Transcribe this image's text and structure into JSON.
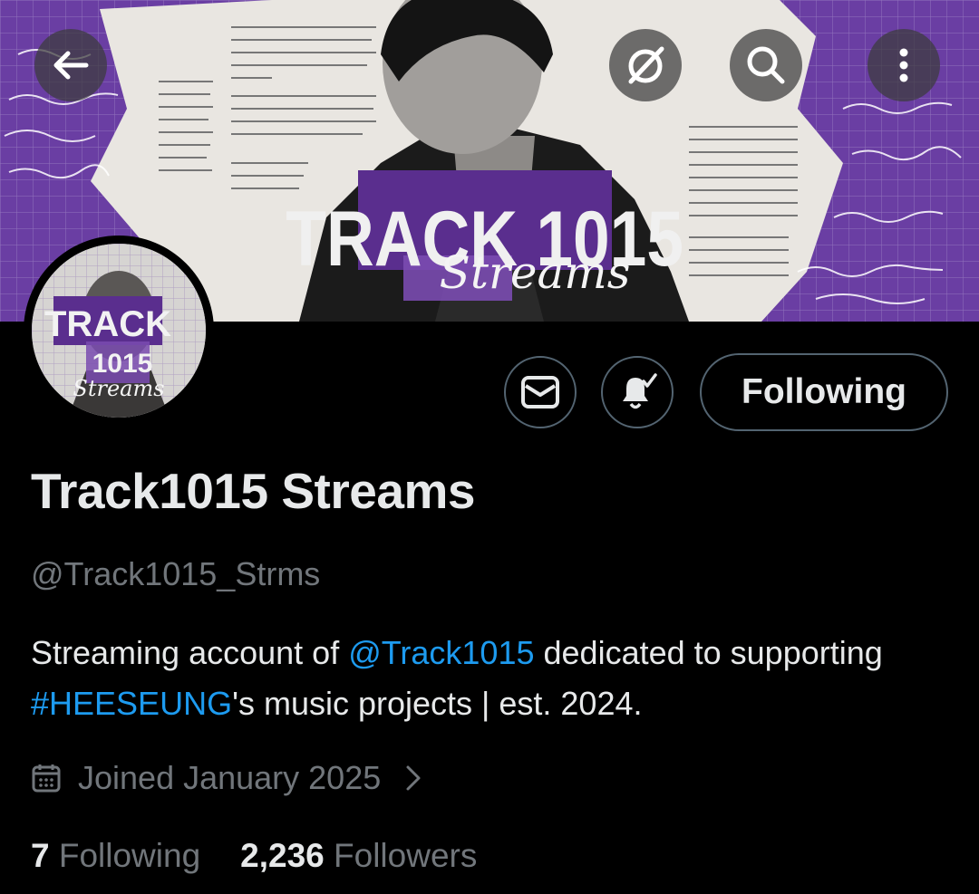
{
  "header": {
    "back_icon": "arrow-left-icon",
    "grok_icon": "grok-icon",
    "search_icon": "search-icon",
    "more_icon": "more-vertical-icon"
  },
  "banner": {
    "logo_line1": "TRACK 1015",
    "logo_line2": "Streams"
  },
  "avatar": {
    "logo_line1": "TRACK",
    "logo_line2": "1015",
    "logo_line3": "Streams"
  },
  "actions": {
    "message_icon": "mail-icon",
    "notify_icon": "bell-check-icon",
    "follow_label": "Following"
  },
  "profile": {
    "display_name": "Track1015 Streams",
    "handle": "@Track1015_Strms",
    "bio": {
      "part1": "Streaming account of ",
      "mention": "@Track1015",
      "part2": " dedicated to supporting ",
      "hashtag": "#HEESEUNG",
      "part3": "'s music projects | est. 2024."
    },
    "joined": "Joined January 2025"
  },
  "stats": {
    "following_count": "7",
    "following_label": "Following",
    "followers_count": "2,236",
    "followers_label": "Followers"
  },
  "colors": {
    "accent": "#1d9bf0",
    "banner_purple": "#6a3ea3",
    "muted": "#71767b",
    "border": "#536471"
  }
}
